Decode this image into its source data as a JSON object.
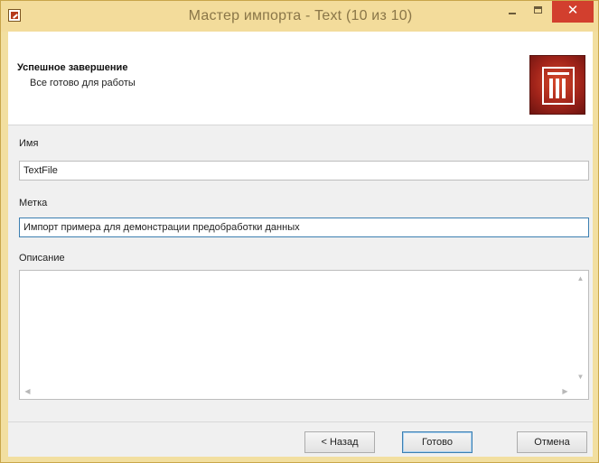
{
  "window": {
    "title": "Мастер импорта - Text (10 из 10)",
    "close_glyph": "✕"
  },
  "header": {
    "title": "Успешное завершение",
    "subtitle": "Все готово для работы"
  },
  "form": {
    "name_label": "Имя",
    "name_value": "TextFile",
    "tag_label": "Метка",
    "tag_value": "Импорт примера для демонстрации предобработки данных",
    "description_label": "Описание",
    "description_value": ""
  },
  "scroll_glyphs": {
    "up": "▲",
    "down": "▼",
    "left": "◀",
    "right": "▶"
  },
  "footer": {
    "back_label": "< Назад",
    "finish_label": "Готово",
    "cancel_label": "Отмена"
  },
  "colors": {
    "titlebar": "#f3dc9b",
    "close_button": "#d23f2e",
    "logo": "#a2241a",
    "focus_border": "#3c7fb1"
  }
}
